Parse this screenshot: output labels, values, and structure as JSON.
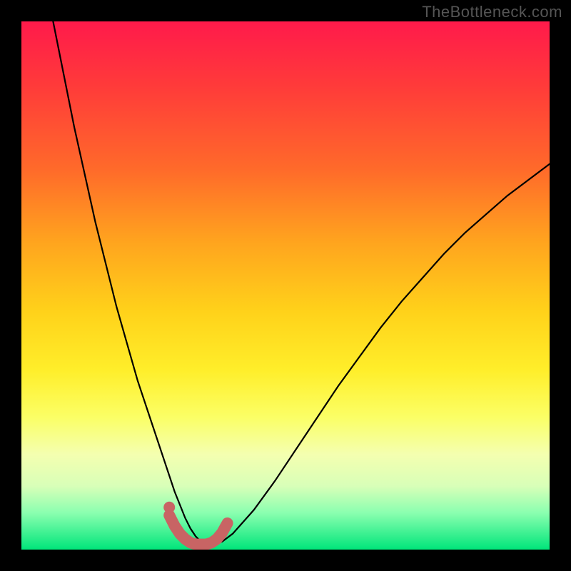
{
  "watermark": "TheBottleneck.com",
  "chart_data": {
    "type": "line",
    "title": "",
    "xlabel": "",
    "ylabel": "",
    "xlim": [
      0,
      100
    ],
    "ylim": [
      0,
      100
    ],
    "series": [
      {
        "name": "bottleneck-curve",
        "x": [
          6,
          8,
          10,
          12,
          14,
          16,
          18,
          20,
          22,
          24,
          26,
          28,
          29,
          30,
          31,
          32,
          33,
          34,
          35,
          36,
          38,
          40,
          44,
          48,
          52,
          56,
          60,
          64,
          68,
          72,
          76,
          80,
          84,
          88,
          92,
          96,
          100
        ],
        "y": [
          100,
          90,
          80,
          71,
          62,
          54,
          46,
          39,
          32,
          26,
          20,
          14,
          11,
          8.5,
          6,
          4,
          2.5,
          1.5,
          1,
          1,
          1.5,
          3,
          7.5,
          13,
          19,
          25,
          31,
          36.5,
          42,
          47,
          51.5,
          56,
          60,
          63.5,
          67,
          70,
          73
        ]
      }
    ],
    "highlight_band": {
      "name": "optimal-range",
      "color": "#c86464",
      "x": [
        28,
        29,
        30,
        31,
        32,
        33,
        34,
        35,
        36,
        37,
        38,
        39
      ],
      "y": [
        6.5,
        4.5,
        3,
        2,
        1.3,
        1,
        1,
        1,
        1.3,
        2,
        3.2,
        5
      ]
    },
    "highlight_dot": {
      "x": 28,
      "y": 8,
      "color": "#c86464"
    }
  }
}
